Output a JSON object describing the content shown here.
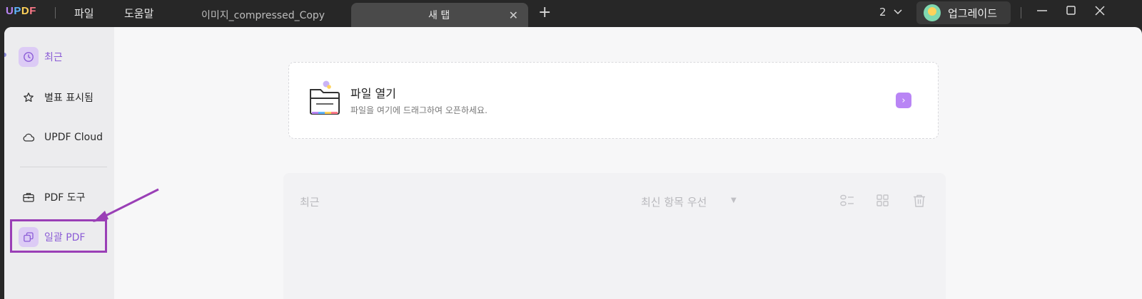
{
  "app": {
    "logo": "UPDF",
    "menu": [
      "파일",
      "도움말"
    ]
  },
  "tabs": [
    {
      "label": "이미지_compressed_Copy",
      "active": false
    },
    {
      "label": "새 탭",
      "active": true
    }
  ],
  "titlebar": {
    "page_count": "2",
    "upgrade_label": "업그레이드"
  },
  "sidebar": {
    "items": [
      {
        "label": "최근",
        "icon": "clock-icon",
        "active": true
      },
      {
        "label": "별표 표시됨",
        "icon": "star-icon",
        "active": false
      },
      {
        "label": "UPDF Cloud",
        "icon": "cloud-icon",
        "active": false
      },
      {
        "label": "PDF 도구",
        "icon": "briefcase-icon",
        "active": false
      },
      {
        "label": "일괄 PDF",
        "icon": "batch-icon",
        "active": false
      }
    ]
  },
  "open_file": {
    "title": "파일 열기",
    "subtitle": "파일을 여기에 드래그하여 오픈하세요."
  },
  "recent": {
    "title": "최근",
    "sort_label": "최신 항목 우선"
  },
  "colors": {
    "accent": "#b985f5",
    "annotation": "#9a3fb6"
  }
}
